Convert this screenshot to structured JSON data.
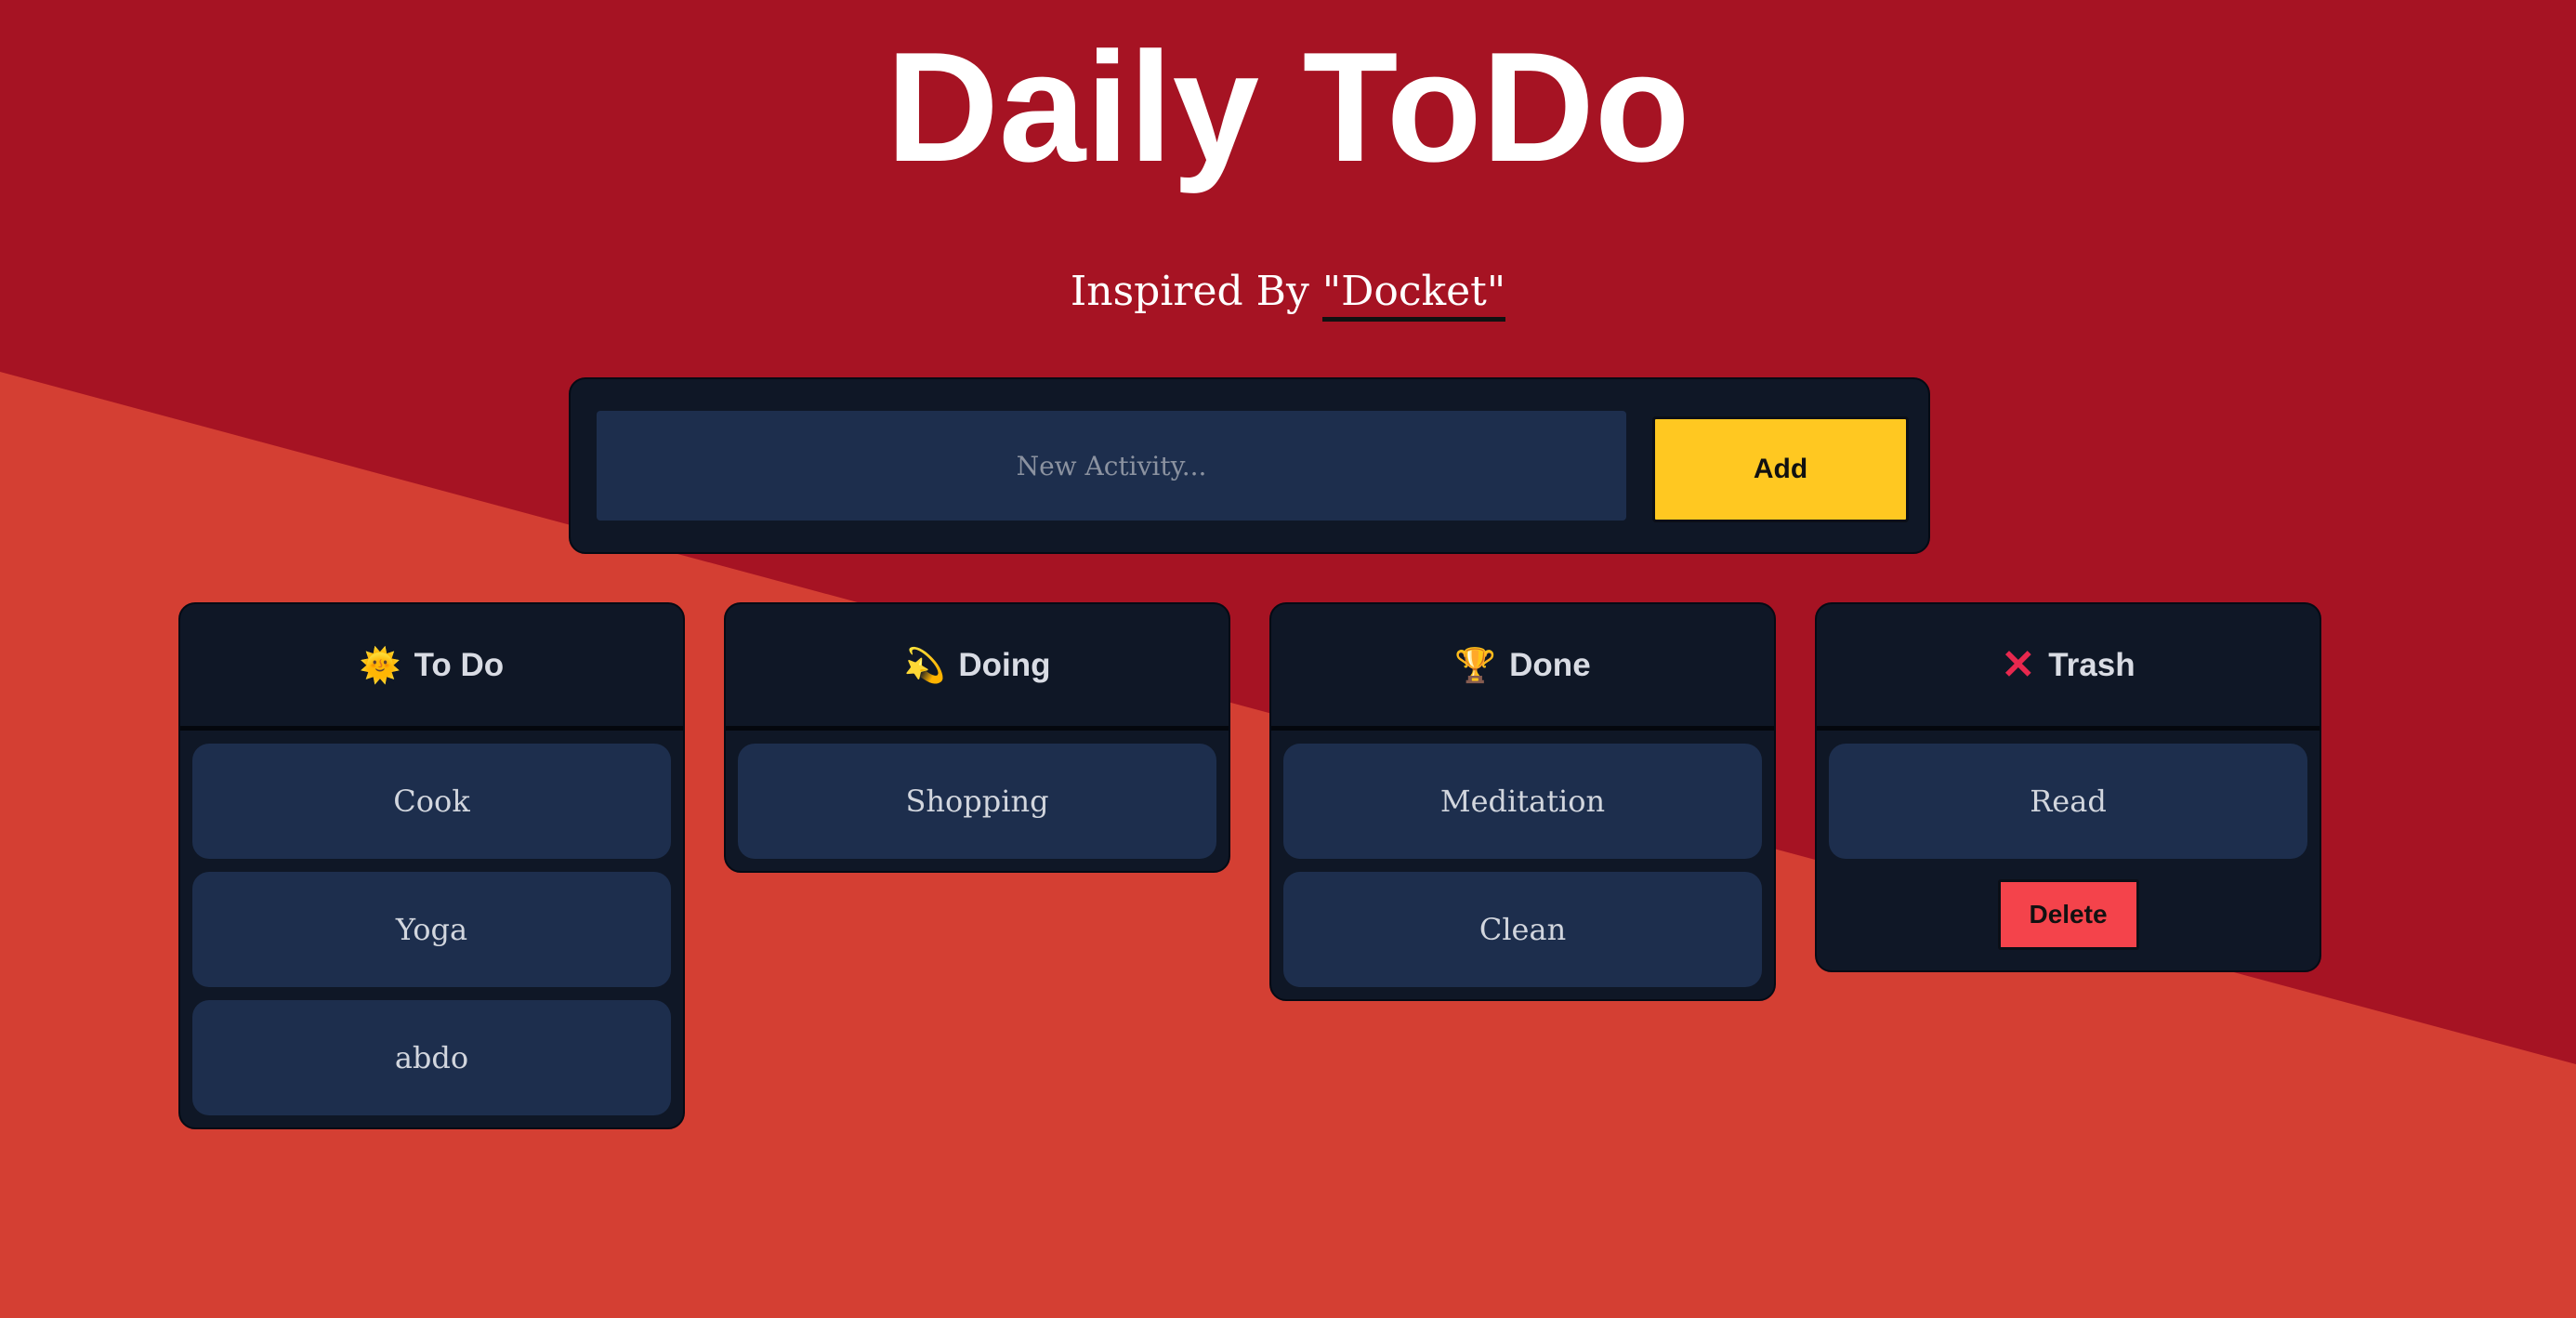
{
  "header": {
    "title": "Daily ToDo",
    "subtitle_prefix": "Inspired By ",
    "subtitle_link": "\"Docket\""
  },
  "add_bar": {
    "placeholder": "New Activity...",
    "value": "",
    "add_label": "Add"
  },
  "columns": [
    {
      "title": "To Do",
      "icon": "sun-icon",
      "glyph": "🌞",
      "items": [
        "Cook",
        "Yoga",
        "abdo"
      ]
    },
    {
      "title": "Doing",
      "icon": "comet-icon",
      "glyph": "💫",
      "items": [
        "Shopping"
      ]
    },
    {
      "title": "Done",
      "icon": "trophy-icon",
      "glyph": "🏆",
      "items": [
        "Meditation",
        "Clean"
      ]
    },
    {
      "title": "Trash",
      "icon": "cross-icon",
      "glyph": "✕",
      "items": [
        "Read"
      ],
      "delete_label": "Delete"
    }
  ],
  "colors": {
    "background_dark": "#a61323",
    "background_light": "#d43f33",
    "panel": "#0f1726",
    "card": "#1d2e4d",
    "accent_yellow": "#ffc821",
    "delete_red": "#f4434b"
  }
}
